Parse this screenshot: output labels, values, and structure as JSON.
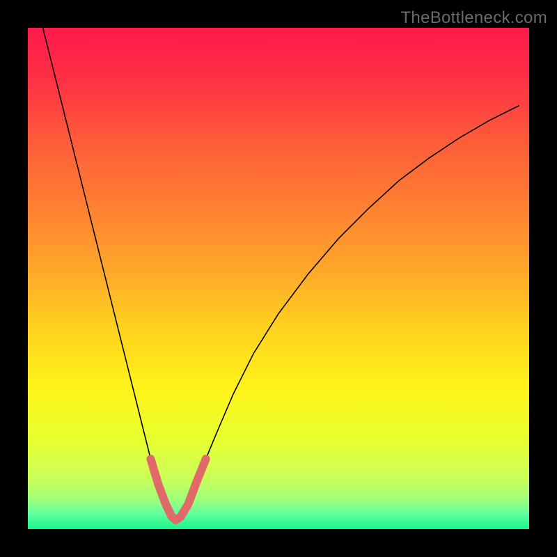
{
  "watermark": "TheBottleneck.com",
  "gradient_stops": [
    {
      "offset": 0.0,
      "color": "#ff1b4a"
    },
    {
      "offset": 0.1,
      "color": "#ff2f45"
    },
    {
      "offset": 0.22,
      "color": "#ff5a3a"
    },
    {
      "offset": 0.35,
      "color": "#ff7e32"
    },
    {
      "offset": 0.48,
      "color": "#ffa62a"
    },
    {
      "offset": 0.6,
      "color": "#ffd21f"
    },
    {
      "offset": 0.72,
      "color": "#fff31a"
    },
    {
      "offset": 0.82,
      "color": "#e8ff2f"
    },
    {
      "offset": 0.9,
      "color": "#c8ff5a"
    },
    {
      "offset": 0.94,
      "color": "#9fff7a"
    },
    {
      "offset": 0.97,
      "color": "#5fff9f"
    },
    {
      "offset": 1.0,
      "color": "#17f58c"
    }
  ],
  "chart_data": {
    "type": "line",
    "title": "",
    "xlabel": "",
    "ylabel": "",
    "xlim": [
      0,
      100
    ],
    "ylim": [
      0,
      100
    ],
    "legend": "none",
    "grid": false,
    "series": [
      {
        "name": "bottleneck-curve",
        "stroke": "#000000",
        "stroke_width": 1.6,
        "x": [
          3,
          5,
          7,
          9,
          11,
          13,
          15,
          17,
          19,
          21,
          23,
          24.5,
          26,
          27.5,
          28.7,
          29.5,
          30.5,
          32,
          33.5,
          35.5,
          38,
          41,
          45,
          50,
          56,
          62,
          68,
          74,
          80,
          86,
          92,
          98
        ],
        "y": [
          100,
          92,
          84,
          76,
          68,
          60,
          52,
          44,
          36,
          28,
          20,
          14,
          9,
          5,
          2.5,
          1.8,
          2.5,
          5,
          9,
          14,
          20,
          27,
          35,
          43,
          51,
          58,
          64,
          69.5,
          74,
          78,
          81.5,
          84.5
        ]
      }
    ],
    "marker_segment": {
      "name": "optimal-range-marker",
      "stroke": "#e06a6a",
      "stroke_width": 12,
      "linecap": "round",
      "x": [
        24.5,
        26,
        27.5,
        28.7,
        29.5,
        30.5,
        32,
        33.5,
        35.5
      ],
      "y": [
        14,
        9,
        5,
        2.5,
        1.8,
        2.5,
        5,
        9,
        14
      ]
    }
  }
}
